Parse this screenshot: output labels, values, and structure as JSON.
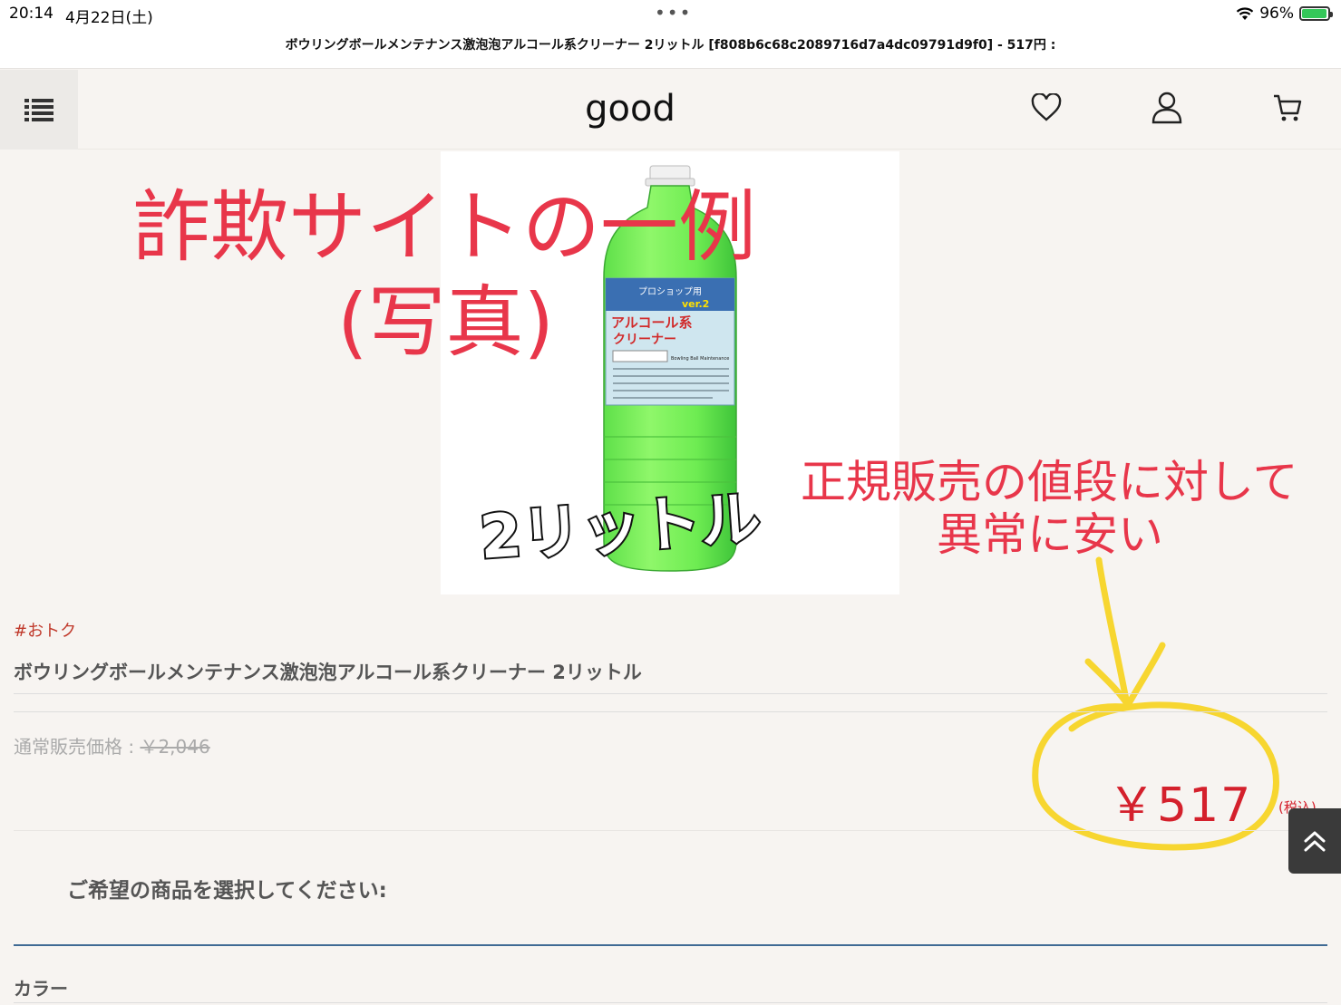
{
  "status": {
    "time": "20:14",
    "date": "4月22日(土)",
    "battery": "96%",
    "battery_level": 0.96
  },
  "page_title": "ボウリングボールメンテナンス激泡泡アルコール系クリーナー 2リットル [f808b6c68c2089716d7a4dc09791d9f0] - 517円 :",
  "header": {
    "logo": "good",
    "icons": [
      "menu-list-icon",
      "heart-icon",
      "user-icon",
      "cart-icon"
    ]
  },
  "product_image": {
    "label_top": "プロショップ用",
    "label_ver": "ver.2",
    "label_main1": "アルコール系",
    "label_main2": "クリーナー",
    "label_sub": "Bowling Ball Maintenance",
    "caption": "2リットル"
  },
  "annotations": {
    "title_line1": "詐欺サイトの一例",
    "title_line2": "(写真)",
    "note_line1": "正規販売の値段に対して",
    "note_line2": "異常に安い"
  },
  "product": {
    "tag": "#おトク",
    "name": "ボウリングボールメンテナンス激泡泡アルコール系クリーナー 2リットル",
    "regular_price_label": "通常販売価格 : ",
    "regular_price": "￥2,046",
    "sale_price": "￥517",
    "tax_note": "(税込)"
  },
  "options": {
    "select_prompt": "ご希望の商品を選択してください:",
    "color_label": "カラー"
  },
  "colors": {
    "accent_red": "#d4202c",
    "annotation_red": "#e8364a",
    "annotation_yellow": "#f7d630",
    "divider_blue": "#3f6a94"
  }
}
